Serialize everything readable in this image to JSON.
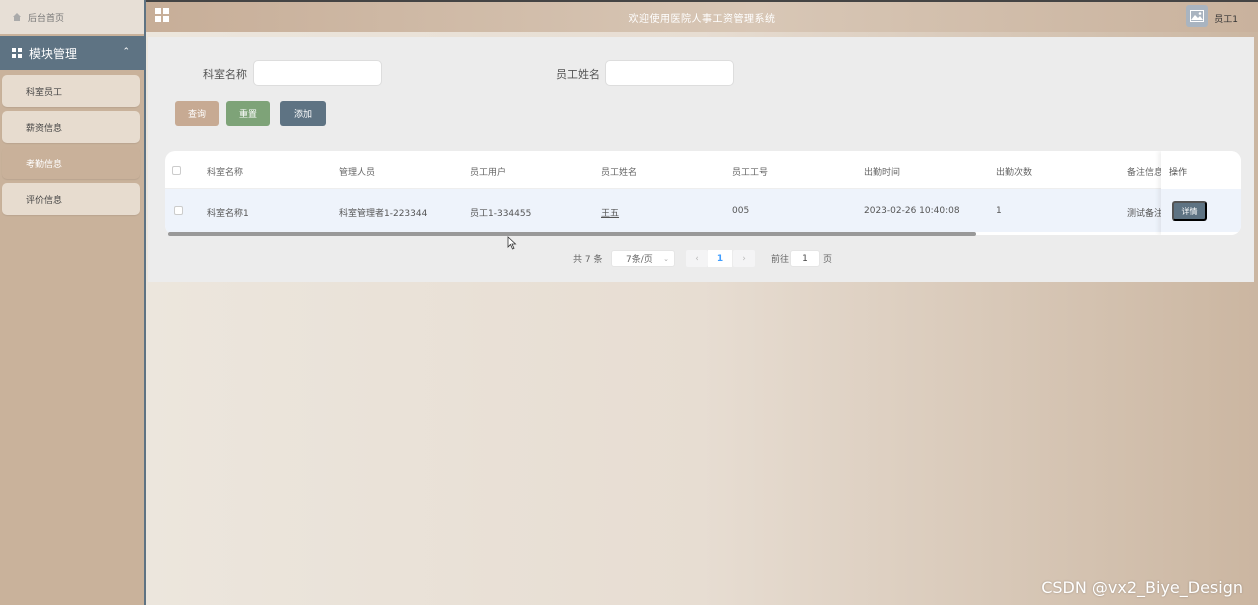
{
  "app": {
    "title": "欢迎使用医院人事工资管理系统",
    "user": "员工1"
  },
  "sidebar": {
    "home": "后台首页",
    "module": "模块管理",
    "items": [
      {
        "label": "科室员工"
      },
      {
        "label": "薪资信息"
      },
      {
        "label": "考勤信息",
        "active": true
      },
      {
        "label": "评价信息"
      }
    ]
  },
  "search": {
    "dept_label": "科室名称",
    "dept_value": "",
    "name_label": "员工姓名",
    "name_value": ""
  },
  "buttons": {
    "query": "查询",
    "reset": "重置",
    "add": "添加",
    "detail": "详情"
  },
  "table": {
    "columns": [
      "科室名称",
      "管理人员",
      "员工用户",
      "员工姓名",
      "员工工号",
      "出勤时间",
      "出勤次数",
      "备注信息",
      "操作"
    ],
    "rows": [
      [
        "科室名称1",
        "科室管理者1-223344",
        "员工1-334455",
        "王五",
        "005",
        "2023-02-26 10:40:08",
        "1",
        "测试备注"
      ]
    ]
  },
  "pagination": {
    "total": "共 7 条",
    "page_size": "7条/页",
    "current_page": "1",
    "goto_label": "前往",
    "goto_value": "1",
    "goto_suffix": "页"
  },
  "watermark": "CSDN @vx2_Biye_Design",
  "colors": {
    "primary": "#5e7383",
    "tan": "#c7aa93",
    "green": "#7ea378"
  }
}
